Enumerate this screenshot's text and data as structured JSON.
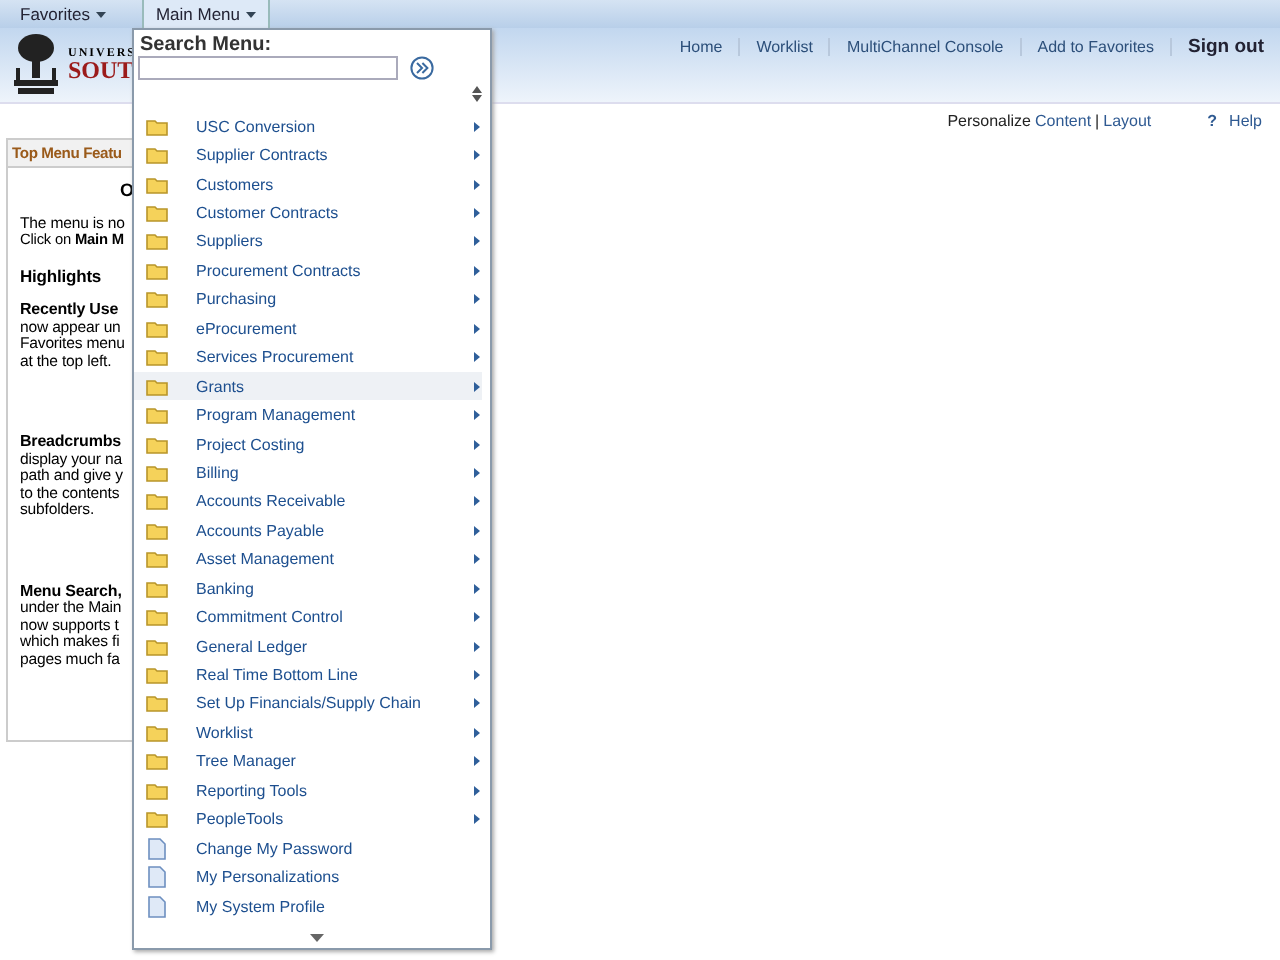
{
  "top_menus": [
    {
      "label": "Favorites",
      "selected": false
    },
    {
      "label": "Main Menu",
      "selected": true
    }
  ],
  "logo": {
    "line_1": "UNIVERS",
    "line_2": "SOUT"
  },
  "nav_links": [
    {
      "label": "Home",
      "kind": "link"
    },
    {
      "label": "Worklist",
      "kind": "link"
    },
    {
      "label": "MultiChannel Console",
      "kind": "link"
    },
    {
      "label": "Add to Favorites",
      "kind": "link"
    },
    {
      "label": "Sign out",
      "kind": "strong"
    }
  ],
  "personalize": {
    "label": "Personalize",
    "content": "Content",
    "separator": "|",
    "layout": "Layout"
  },
  "help": {
    "icon": "?",
    "label": "Help"
  },
  "panel": {
    "title": "Top Menu Featu",
    "lines": [
      {
        "text": "O",
        "kind": "center"
      },
      {
        "text": "The menu is no",
        "kind": "text"
      },
      {
        "text": "Click on **Main M**",
        "kind": "text"
      },
      {
        "text": "Highlights",
        "kind": "heading"
      },
      {
        "text": "Recently Use",
        "kind": "bold"
      },
      {
        "text": "now appear un",
        "kind": "text"
      },
      {
        "text": "Favorites menu",
        "kind": "text"
      },
      {
        "text": "at the top left.",
        "kind": "text"
      },
      {
        "text": "Breadcrumbs",
        "kind": "bold"
      },
      {
        "text": "display your na",
        "kind": "text"
      },
      {
        "text": "path and give y",
        "kind": "text"
      },
      {
        "text": "to the contents",
        "kind": "text"
      },
      {
        "text": "subfolders.",
        "kind": "text"
      },
      {
        "text": "Menu Search,",
        "kind": "bold"
      },
      {
        "text": "under the Main",
        "kind": "text"
      },
      {
        "text": "now supports t",
        "kind": "text"
      },
      {
        "text": "which makes fi",
        "kind": "text"
      },
      {
        "text": "pages much fa",
        "kind": "text"
      }
    ]
  },
  "main_menu": {
    "search_label": "Search Menu:",
    "items": [
      {
        "label": "USC Conversion",
        "kind": "folder",
        "highlighted": false
      },
      {
        "label": "Supplier Contracts",
        "kind": "folder",
        "highlighted": false
      },
      {
        "label": "Customers",
        "kind": "folder",
        "highlighted": false
      },
      {
        "label": "Customer Contracts",
        "kind": "folder",
        "highlighted": false
      },
      {
        "label": "Suppliers",
        "kind": "folder",
        "highlighted": false
      },
      {
        "label": "Procurement Contracts",
        "kind": "folder",
        "highlighted": false
      },
      {
        "label": "Purchasing",
        "kind": "folder",
        "highlighted": false
      },
      {
        "label": "eProcurement",
        "kind": "folder",
        "highlighted": false
      },
      {
        "label": "Services Procurement",
        "kind": "folder",
        "highlighted": false
      },
      {
        "label": "Grants",
        "kind": "folder",
        "highlighted": true
      },
      {
        "label": "Program Management",
        "kind": "folder",
        "highlighted": false
      },
      {
        "label": "Project Costing",
        "kind": "folder",
        "highlighted": false
      },
      {
        "label": "Billing",
        "kind": "folder",
        "highlighted": false
      },
      {
        "label": "Accounts Receivable",
        "kind": "folder",
        "highlighted": false
      },
      {
        "label": "Accounts Payable",
        "kind": "folder",
        "highlighted": false
      },
      {
        "label": "Asset Management",
        "kind": "folder",
        "highlighted": false
      },
      {
        "label": "Banking",
        "kind": "folder",
        "highlighted": false
      },
      {
        "label": "Commitment Control",
        "kind": "folder",
        "highlighted": false
      },
      {
        "label": "General Ledger",
        "kind": "folder",
        "highlighted": false
      },
      {
        "label": "Real Time Bottom Line",
        "kind": "folder",
        "highlighted": false
      },
      {
        "label": "Set Up Financials/Supply Chain",
        "kind": "folder",
        "highlighted": false
      },
      {
        "label": "Worklist",
        "kind": "folder",
        "highlighted": false
      },
      {
        "label": "Tree Manager",
        "kind": "folder",
        "highlighted": false
      },
      {
        "label": "Reporting Tools",
        "kind": "folder",
        "highlighted": false
      },
      {
        "label": "PeopleTools",
        "kind": "folder",
        "highlighted": false
      },
      {
        "label": "Change My Password",
        "kind": "page",
        "highlighted": false
      },
      {
        "label": "My Personalizations",
        "kind": "page",
        "highlighted": false
      },
      {
        "label": "My System Profile",
        "kind": "page",
        "highlighted": false
      }
    ]
  }
}
